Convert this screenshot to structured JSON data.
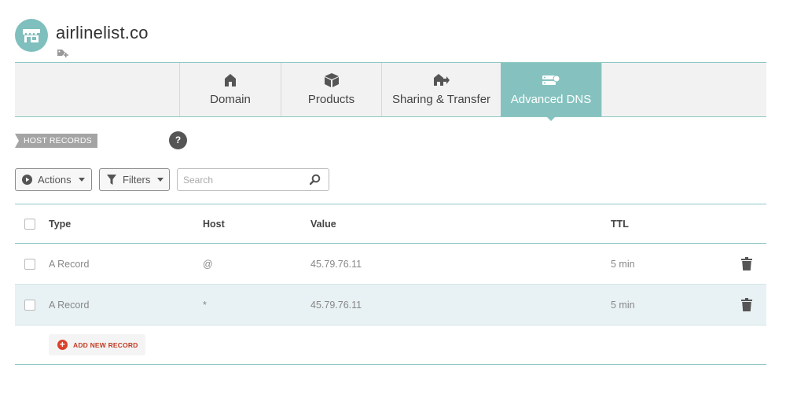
{
  "header": {
    "domain": "airlinelist.co",
    "avatar_icon": "storefront-icon",
    "tag_icon": "tag-add-icon"
  },
  "tabs": [
    {
      "label": "Domain",
      "icon": "home-icon",
      "active": false
    },
    {
      "label": "Products",
      "icon": "box-icon",
      "active": false
    },
    {
      "label": "Sharing & Transfer",
      "icon": "share-transfer-icon",
      "active": false
    },
    {
      "label": "Advanced DNS",
      "icon": "server-icon",
      "active": true
    }
  ],
  "section": {
    "label": "HOST RECORDS",
    "help": "?"
  },
  "toolbar": {
    "actions_label": "Actions",
    "filters_label": "Filters",
    "search_placeholder": "Search",
    "search_value": ""
  },
  "table": {
    "columns": [
      "Type",
      "Host",
      "Value",
      "TTL"
    ],
    "rows": [
      {
        "type": "A Record",
        "host": "@",
        "value": "45.79.76.11",
        "ttl": "5 min"
      },
      {
        "type": "A Record",
        "host": "*",
        "value": "45.79.76.11",
        "ttl": "5 min"
      }
    ]
  },
  "add_record_label": "ADD NEW RECORD",
  "colors": {
    "accent": "#85c2bf",
    "add": "#d9412b"
  }
}
